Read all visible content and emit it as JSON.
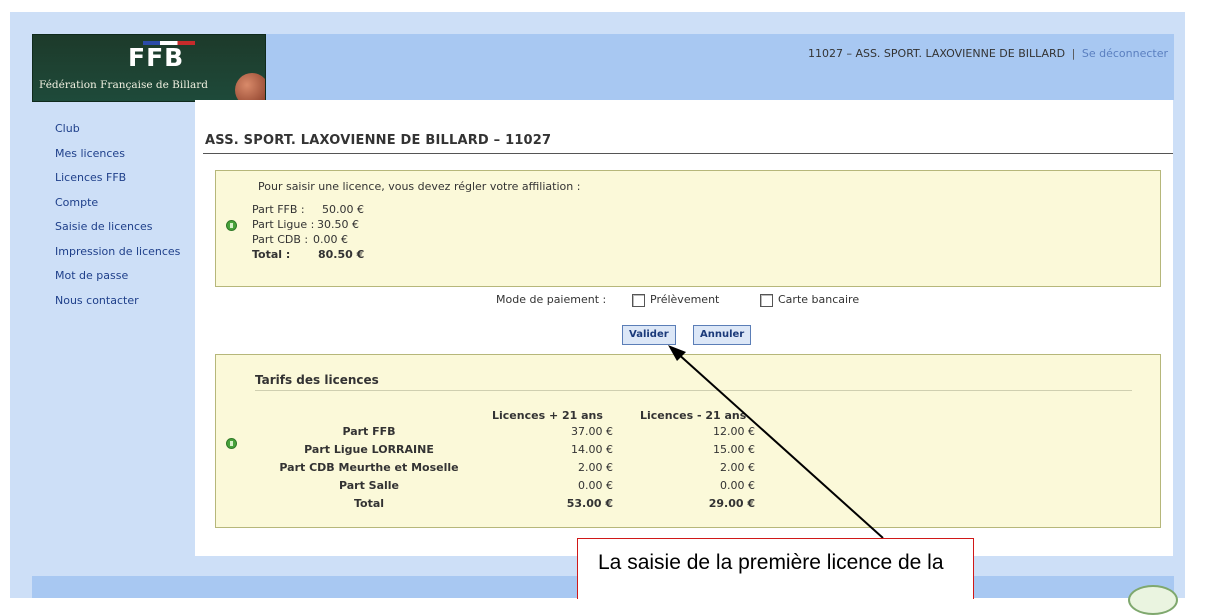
{
  "header": {
    "logo_text": "FFB",
    "logo_subtitle": "Fédération Française de Billard",
    "account": "11027 – ASS. SPORT. LAXOVIENNE DE BILLARD",
    "separator": "|",
    "logout_label": "Se déconnecter"
  },
  "sidebar": {
    "items": [
      {
        "label": "Club"
      },
      {
        "label": "Mes licences"
      },
      {
        "label": "Licences FFB"
      },
      {
        "label": "Compte"
      },
      {
        "label": "Saisie de licences"
      },
      {
        "label": "Impression de licences"
      },
      {
        "label": "Mot de passe"
      },
      {
        "label": "Nous contacter"
      }
    ]
  },
  "main": {
    "title": "ASS. SPORT. LAXOVIENNE DE BILLARD – 11027",
    "affiliation": {
      "intro": "Pour saisir une licence, vous devez régler votre affiliation :",
      "lines": [
        {
          "label": "Part FFB :",
          "value": "50.00 €"
        },
        {
          "label": "Part Ligue :",
          "value": "30.50 €"
        },
        {
          "label": "Part CDB :",
          "value": "0.00 €"
        }
      ],
      "total_label": "Total :",
      "total_value": "80.50 €"
    },
    "payment": {
      "label": "Mode de paiement :",
      "options": [
        {
          "label": "Prélèvement",
          "checked": false
        },
        {
          "label": "Carte bancaire",
          "checked": false
        }
      ]
    },
    "buttons": {
      "validate": "Valider",
      "cancel": "Annuler"
    },
    "tariffs": {
      "title": "Tarifs des licences",
      "columns": [
        "Licences + 21 ans",
        "Licences - 21 ans"
      ],
      "rows": [
        {
          "label": "Part FFB",
          "over21": "37.00 €",
          "under21": "12.00 €"
        },
        {
          "label": "Part Ligue LORRAINE",
          "over21": "14.00 €",
          "under21": "15.00 €"
        },
        {
          "label": "Part CDB Meurthe et Moselle",
          "over21": "2.00 €",
          "under21": "2.00 €"
        },
        {
          "label": "Part Salle",
          "over21": "0.00 €",
          "under21": "0.00 €"
        },
        {
          "label": "Total",
          "over21": "53.00 €",
          "under21": "29.00 €"
        }
      ]
    }
  },
  "annotation": {
    "text": "La saisie de la première licence de la"
  },
  "colors": {
    "header_bg": "#a8c8f2",
    "box_bg": "#fbf9d9",
    "callout_border": "#d01818",
    "link": "#1e3f8a"
  }
}
